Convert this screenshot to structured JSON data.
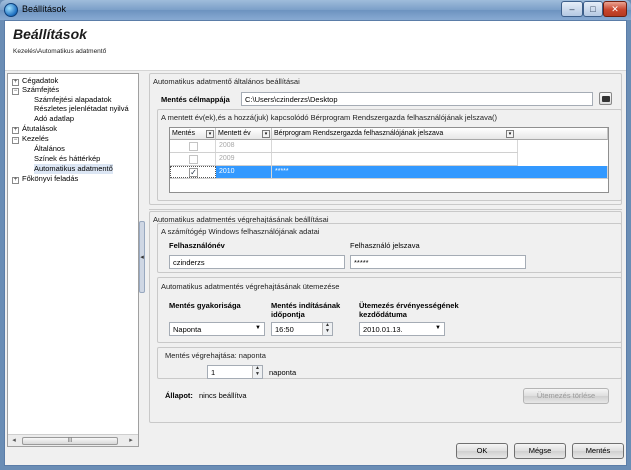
{
  "window": {
    "title": "Beállítások",
    "minimize": "–",
    "maximize": "□",
    "close": "✕"
  },
  "header": {
    "title": "Beállítások",
    "breadcrumb": "Kezelés\\Automatikus adatmentő"
  },
  "tree": {
    "items": [
      {
        "label": "Cégadatok",
        "expander": "+"
      },
      {
        "label": "Számfejtés",
        "expander": "−"
      },
      {
        "label": "Számfejtési alapadatok"
      },
      {
        "label": "Részletes jelenlétadat nyilvá"
      },
      {
        "label": "Adó adatlap"
      },
      {
        "label": "Átutalások",
        "expander": "+"
      },
      {
        "label": "Kezelés",
        "expander": "−"
      },
      {
        "label": "Általános"
      },
      {
        "label": "Színek és háttérkép"
      },
      {
        "label": "Automatikus adatmentő"
      },
      {
        "label": "Főkönyvi feladás",
        "expander": "+"
      }
    ],
    "scroll_left": "◂",
    "scroll_right": "▸",
    "scroll_thumb": "III"
  },
  "splitter_arrow": "◂",
  "general": {
    "title": "Automatikus adatmentő általános beállításai",
    "target_label": "Mentés célmappája",
    "target_value": "C:\\Users\\czinderzs\\Desktop",
    "years_title": "A mentett év(ek),és a hozzá(juk) kapcsolódó Bérprogram Rendszergazda felhasználójának jelszava()",
    "grid": {
      "columns": [
        "Mentés",
        "Mentett év",
        "Bérprogram Rendszergazda felhasználójának jelszava"
      ],
      "rows": [
        {
          "checked": false,
          "year": "2008",
          "password": ""
        },
        {
          "checked": false,
          "year": "2009",
          "password": ""
        },
        {
          "checked": true,
          "year": "2010",
          "password": "*****"
        }
      ]
    }
  },
  "exec": {
    "title": "Automatikus  adatmentés végrehajtásának beállításai",
    "windows_title": "A számítógép Windows felhasználójának adatai",
    "username_label": "Felhasználónév",
    "username_value": "czinderzs",
    "password_label": "Felhasználó jelszava",
    "password_value": "*****",
    "schedule_title": "Automatikus adatmentés végrehajtásának ütemezése",
    "freq_label": "Mentés gyakorisága",
    "freq_value": "Naponta",
    "start_label": "Mentés indításának időpontja",
    "start_value": "16:50",
    "valid_label": "Ütemezés érvényességének kezdődátuma",
    "valid_value": "2010.01.13.",
    "run_title": "Mentés végrehajtása: naponta",
    "run_value": "1",
    "run_unit": "naponta",
    "status_label": "Állapot:",
    "status_value": "nincs beállítva",
    "clear_button": "Ütemezés törlése"
  },
  "buttons": {
    "ok": "OK",
    "cancel": "Mégse",
    "save": "Mentés"
  }
}
